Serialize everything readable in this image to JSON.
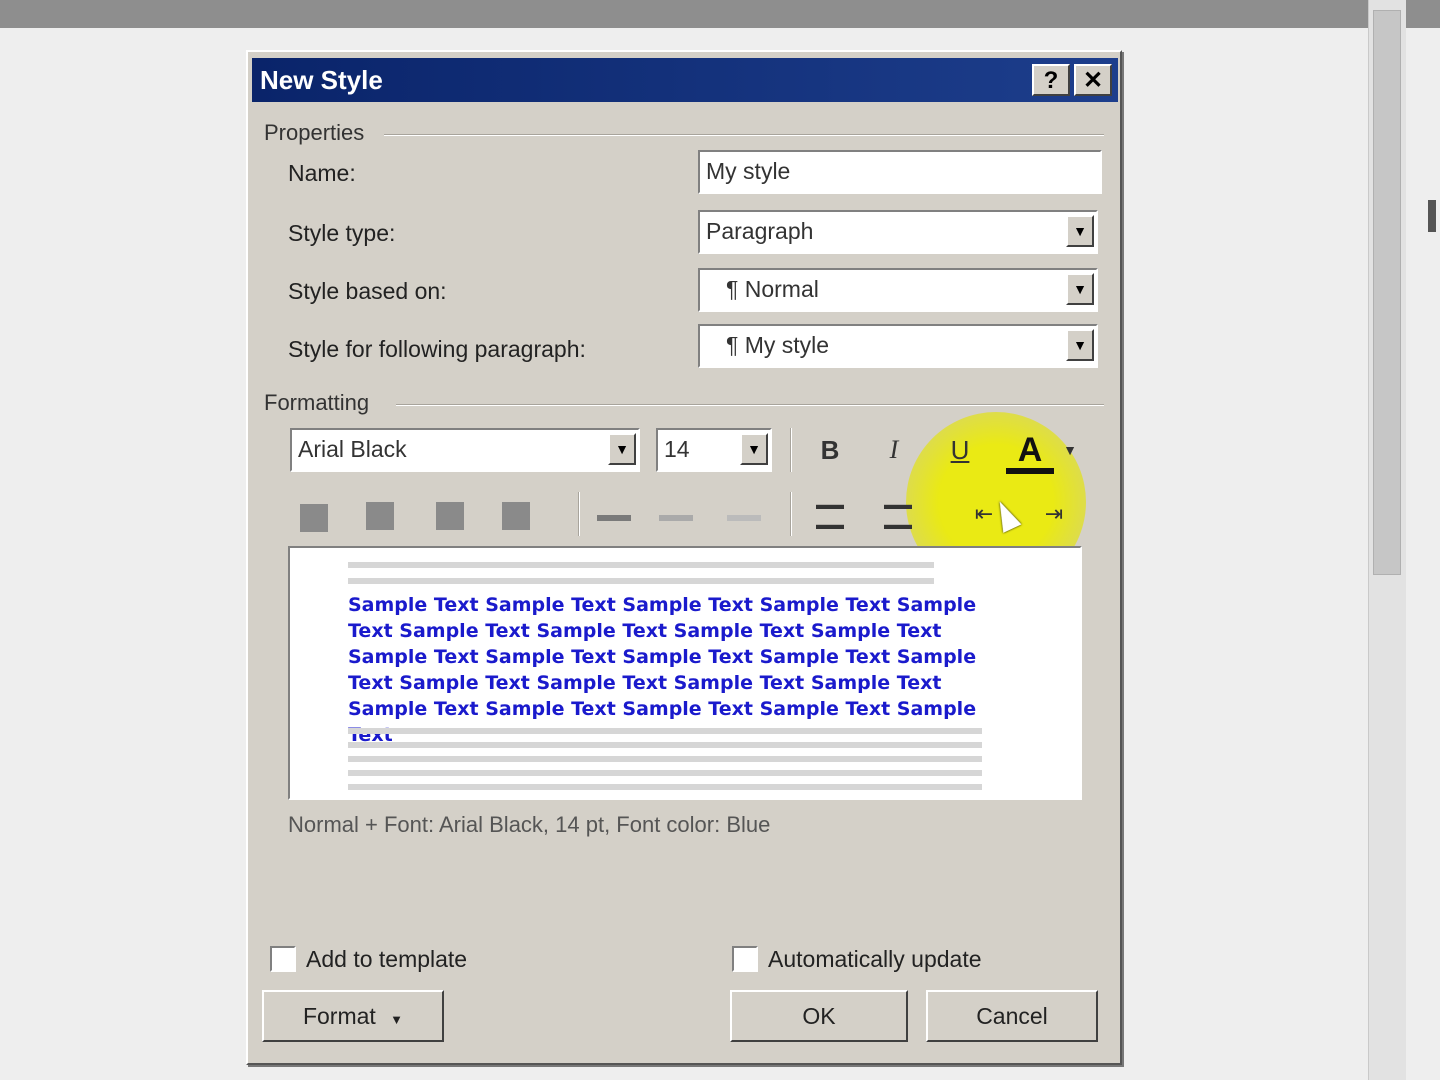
{
  "dialog": {
    "title": "New Style",
    "properties": {
      "group_label": "Properties",
      "name_label": "Name:",
      "name_value": "My style",
      "style_type_label": "Style type:",
      "style_type_value": "Paragraph",
      "based_on_label": "Style based on:",
      "based_on_value": "¶ Normal",
      "following_label": "Style for following paragraph:",
      "following_value": "¶ My style"
    },
    "formatting": {
      "group_label": "Formatting",
      "font_value": "Arial Black",
      "size_value": "14",
      "bold_glyph": "B",
      "italic_glyph": "I",
      "underline_glyph": "U",
      "font_color_glyph": "A"
    },
    "preview": {
      "sample_text": "Sample Text Sample Text Sample Text Sample Text Sample Text Sample Text Sample Text Sample Text Sample Text Sample Text Sample Text Sample Text Sample Text Sample Text Sample Text Sample Text Sample Text Sample Text Sample Text Sample Text Sample Text Sample Text Sample Text"
    },
    "description": "Normal + Font: Arial Black, 14 pt, Font color: Blue",
    "add_to_template": "Add to template",
    "auto_update": "Automatically update",
    "buttons": {
      "format": "Format",
      "ok": "OK",
      "cancel": "Cancel"
    }
  },
  "colors": {
    "title_bar": "#0a246a",
    "dialog_bg": "#d4d0c8",
    "preview_text": "#1a1acc",
    "highlight": "#ebeb0a"
  }
}
